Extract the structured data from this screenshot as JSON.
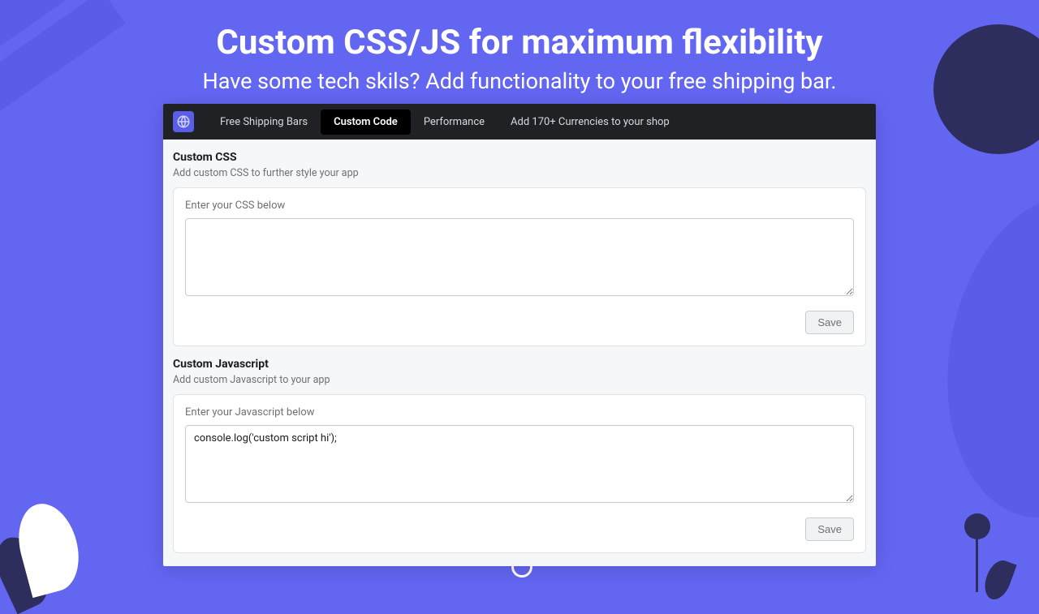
{
  "hero": {
    "title": "Custom CSS/JS for maximum flexibility",
    "subtitle": "Have some tech skils? Add functionality to your free shipping bar."
  },
  "nav": {
    "items": [
      {
        "label": "Free Shipping Bars",
        "active": false
      },
      {
        "label": "Custom Code",
        "active": true
      },
      {
        "label": "Performance",
        "active": false
      },
      {
        "label": "Add 170+ Currencies to your shop",
        "active": false
      }
    ]
  },
  "sections": {
    "css": {
      "title": "Custom CSS",
      "desc": "Add custom CSS to further style your app",
      "field_label": "Enter your CSS below",
      "value": "",
      "save_label": "Save"
    },
    "js": {
      "title": "Custom Javascript",
      "desc": "Add custom Javascript to your app",
      "field_label": "Enter your Javascript below",
      "value": "console.log('custom script hi');",
      "save_label": "Save"
    }
  }
}
